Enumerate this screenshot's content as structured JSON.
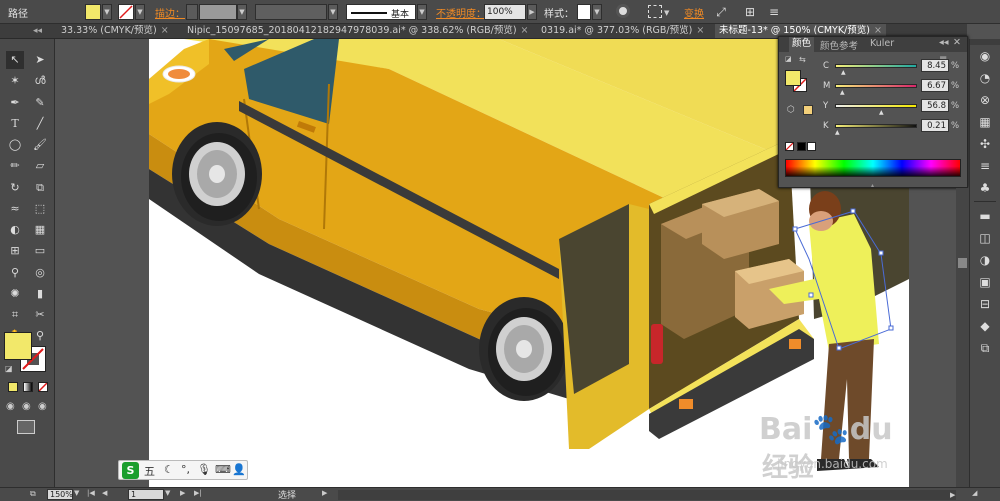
{
  "control_bar": {
    "object_type": "路径",
    "stroke_label": "描边：",
    "stroke_profile": "基本",
    "opacity_label": "不透明度：",
    "opacity_value": "100%",
    "style_label": "样式：",
    "transform_label": "变换",
    "fill_color": "#f2e86a"
  },
  "tabs": [
    {
      "label": "33.33% (CMYK/预览)",
      "active": false
    },
    {
      "label": "Nipic_15097685_20180412182947978039.ai* @ 338.62% (RGB/预览)",
      "active": false
    },
    {
      "label": "0319.ai* @ 377.03% (RGB/预览)",
      "active": false
    },
    {
      "label": "未标题-13* @ 150% (CMYK/预览)",
      "active": true
    }
  ],
  "tab_close": "×",
  "tab_overflow": "»",
  "color_panel": {
    "tabs": [
      "颜色",
      "颜色参考",
      "Kuler"
    ],
    "sliders": [
      {
        "channel": "C",
        "value": "8.45",
        "unit": "%",
        "position": 0.0845
      },
      {
        "channel": "M",
        "value": "6.67",
        "unit": "%",
        "position": 0.0667
      },
      {
        "channel": "Y",
        "value": "56.8",
        "unit": "%",
        "position": 0.568
      },
      {
        "channel": "K",
        "value": "0.21",
        "unit": "%",
        "position": 0.0021
      }
    ],
    "fill_color": "#f2e86a",
    "menu_icon": "≡"
  },
  "tools": {
    "fill_color": "#f2e86a"
  },
  "status_bar": {
    "zoom": "150%",
    "page": "1",
    "mode": "选择"
  },
  "ime": {
    "mode_label": "五"
  },
  "watermark": {
    "brand": "Bai",
    "brand2": "du",
    "cn": "经验",
    "url": "jingyan.baidu.com"
  }
}
